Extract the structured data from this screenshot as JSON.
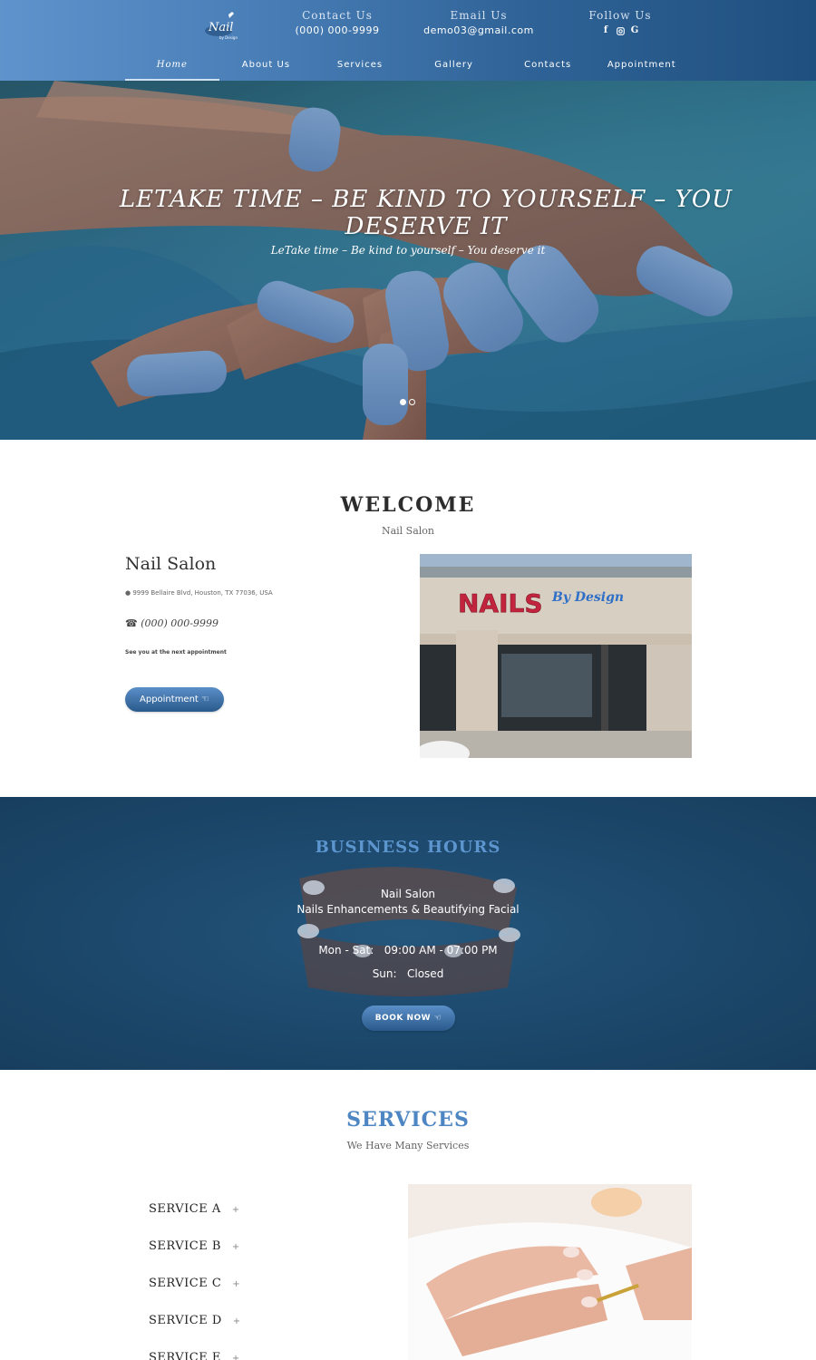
{
  "header": {
    "logo_text": "Nail",
    "logo_small": "by Design",
    "contact": {
      "title": "Contact Us",
      "value": "(000) 000-9999"
    },
    "email": {
      "title": "Email Us",
      "value": "demo03@gmail.com"
    },
    "follow": {
      "title": "Follow Us",
      "icons": [
        "facebook-icon",
        "instagram-icon",
        "google-icon"
      ]
    }
  },
  "nav": [
    {
      "label": "Home",
      "active": true
    },
    {
      "label": "About Us"
    },
    {
      "label": "Services"
    },
    {
      "label": "Gallery"
    },
    {
      "label": "Contacts"
    },
    {
      "label": "Appointment"
    }
  ],
  "hero": {
    "title": "LETAKE TIME – BE KIND TO YOURSELF – YOU DESERVE IT",
    "subtitle": "LeTake time – Be kind to yourself – You deserve it",
    "slides": 2,
    "active_slide": 1
  },
  "welcome": {
    "title": "WELCOME",
    "subtitle": "Nail Salon",
    "name": "Nail Salon",
    "address": "9999 Bellaire Blvd, Houston, TX 77036, USA",
    "phone": "(000) 000-9999",
    "note": "See you at the next appointment",
    "button": "Appointment",
    "store_sign_main": "NAILS",
    "store_sign_script": "By Design"
  },
  "hours": {
    "title": "BUSINESS HOURS",
    "line1": "Nail Salon",
    "line2": "Nails Enhancements & Beautifying Facial",
    "weekday": "Mon - Sat:   09:00 AM - 07:00 PM",
    "sunday": "Sun:   Closed",
    "button": "BOOK NOW"
  },
  "services": {
    "title": "SERVICES",
    "subtitle": "We Have Many Services",
    "items": [
      "SERVICE A",
      "SERVICE B",
      "SERVICE C",
      "SERVICE D",
      "SERVICE E"
    ]
  },
  "colors": {
    "accent": "#4d86c2",
    "header_dark": "#1f4f7e",
    "hours_bg": "#1d4a6e",
    "nail_blue": "#7ea3d6"
  }
}
